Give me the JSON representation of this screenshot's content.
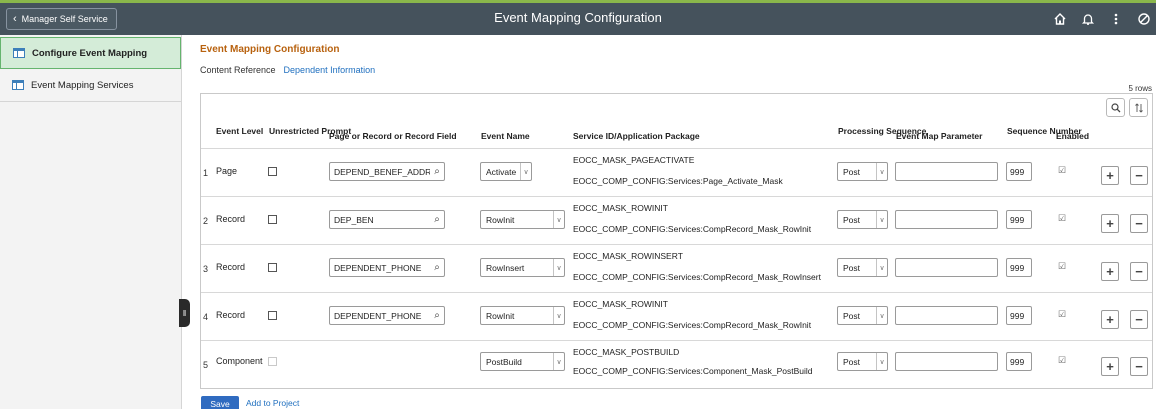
{
  "banner": {
    "back_label": "Manager Self Service",
    "title": "Event Mapping Configuration",
    "icons": [
      "home-icon",
      "bell-icon",
      "more-vertical-icon",
      "navbar-icon"
    ]
  },
  "left_panel": {
    "items": [
      {
        "label": "Configure Event Mapping",
        "active": true
      },
      {
        "label": "Event Mapping Services",
        "active": false
      }
    ]
  },
  "page": {
    "title": "Event Mapping Configuration",
    "subnav_label": "Content Reference",
    "subnav_link": "Dependent Information",
    "rows_count": "5 rows"
  },
  "grid": {
    "headers": {
      "event_level": "Event Level",
      "unrestricted_prompt": "Unrestricted Prompt",
      "page_record": "Page or Record or Record Field",
      "event_name": "Event Name",
      "service_id": "Service ID/Application Package",
      "processing_sequence": "Processing Sequence",
      "event_map_parameter": "Event Map Parameter",
      "sequence_number": "Sequence Number",
      "enabled": "Enabled"
    },
    "rows": [
      {
        "num": "1",
        "level": "Page",
        "prompt_disabled": false,
        "record": "DEPEND_BENEF_ADDR",
        "has_record": true,
        "event": "Activate",
        "service_id": "EOCC_MASK_PAGEACTIVATE",
        "package": "EOCC_COMP_CONFIG:Services:Page_Activate_Mask",
        "sequence": "Post",
        "parameter": "",
        "seq_number": "999",
        "enabled": true
      },
      {
        "num": "2",
        "level": "Record",
        "prompt_disabled": false,
        "record": "DEP_BEN",
        "has_record": true,
        "event": "RowInit",
        "service_id": "EOCC_MASK_ROWINIT",
        "package": "EOCC_COMP_CONFIG:Services:CompRecord_Mask_RowInit",
        "sequence": "Post",
        "parameter": "",
        "seq_number": "999",
        "enabled": true
      },
      {
        "num": "3",
        "level": "Record",
        "prompt_disabled": false,
        "record": "DEPENDENT_PHONE",
        "has_record": true,
        "event": "RowInsert",
        "service_id": "EOCC_MASK_ROWINSERT",
        "package": "EOCC_COMP_CONFIG:Services:CompRecord_Mask_RowInsert",
        "sequence": "Post",
        "parameter": "",
        "seq_number": "999",
        "enabled": true
      },
      {
        "num": "4",
        "level": "Record",
        "prompt_disabled": false,
        "record": "DEPENDENT_PHONE",
        "has_record": true,
        "event": "RowInit",
        "service_id": "EOCC_MASK_ROWINIT",
        "package": "EOCC_COMP_CONFIG:Services:CompRecord_Mask_RowInit",
        "sequence": "Post",
        "parameter": "",
        "seq_number": "999",
        "enabled": true
      },
      {
        "num": "5",
        "level": "Component",
        "prompt_disabled": true,
        "record": "",
        "has_record": false,
        "event": "PostBuild",
        "service_id": "EOCC_MASK_POSTBUILD",
        "package": "EOCC_COMP_CONFIG:Services:Component_Mask_PostBuild",
        "sequence": "Post",
        "parameter": "",
        "seq_number": "999",
        "enabled": true
      }
    ]
  },
  "actions": {
    "save_label": "Save",
    "add_to_project_label": "Add to Project"
  }
}
